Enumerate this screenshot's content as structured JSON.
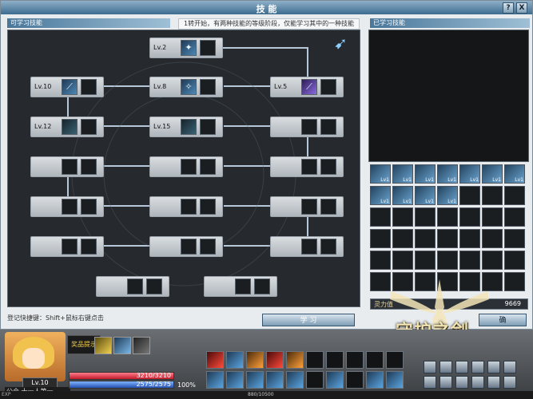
{
  "window": {
    "title": "技 能",
    "help_label": "?",
    "close_label": "X"
  },
  "panels": {
    "learnable_title": "可学习技能",
    "learned_title": "已学习技能",
    "hint": "1转开始，有两种技能的等级阶段，仅能学习其中的一种技能"
  },
  "tree_nodes": [
    {
      "level": "Lv.2",
      "icon": "frost-spike-icon"
    },
    {
      "level": "Lv.10",
      "icon": "ice-blade-icon"
    },
    {
      "level": "Lv.8",
      "icon": "ice-shard-icon"
    },
    {
      "level": "Lv.5",
      "icon": "arcane-slash-icon"
    },
    {
      "level": "Lv.12",
      "icon": "shadow-strike-icon"
    },
    {
      "level": "Lv.15",
      "icon": "frost-wave-icon"
    }
  ],
  "learned_grid": {
    "row1_levels": [
      "Lv1",
      "Lv1",
      "Lv1",
      "Lv1",
      "Lv1",
      "Lv1",
      "Lv1"
    ],
    "row2_levels": [
      "Lv1",
      "Lv1",
      "Lv1",
      "Lv1"
    ]
  },
  "skill_points": {
    "label": "灵力值",
    "value": "9669"
  },
  "footer": {
    "shortcut_hint": "登记快捷键：Shift+鼠标右键点击",
    "learn_button": "学 习",
    "confirm_button": "确"
  },
  "game_logo": "守护之剑",
  "hud": {
    "reward_label": "奖品提示",
    "level": "Lv.10",
    "guild": "公会 十一人第一",
    "hp": "3210/3210",
    "mp": "2575/2575",
    "percent": "100%",
    "exp_label": "EXP",
    "exp_value": "880/10500"
  }
}
